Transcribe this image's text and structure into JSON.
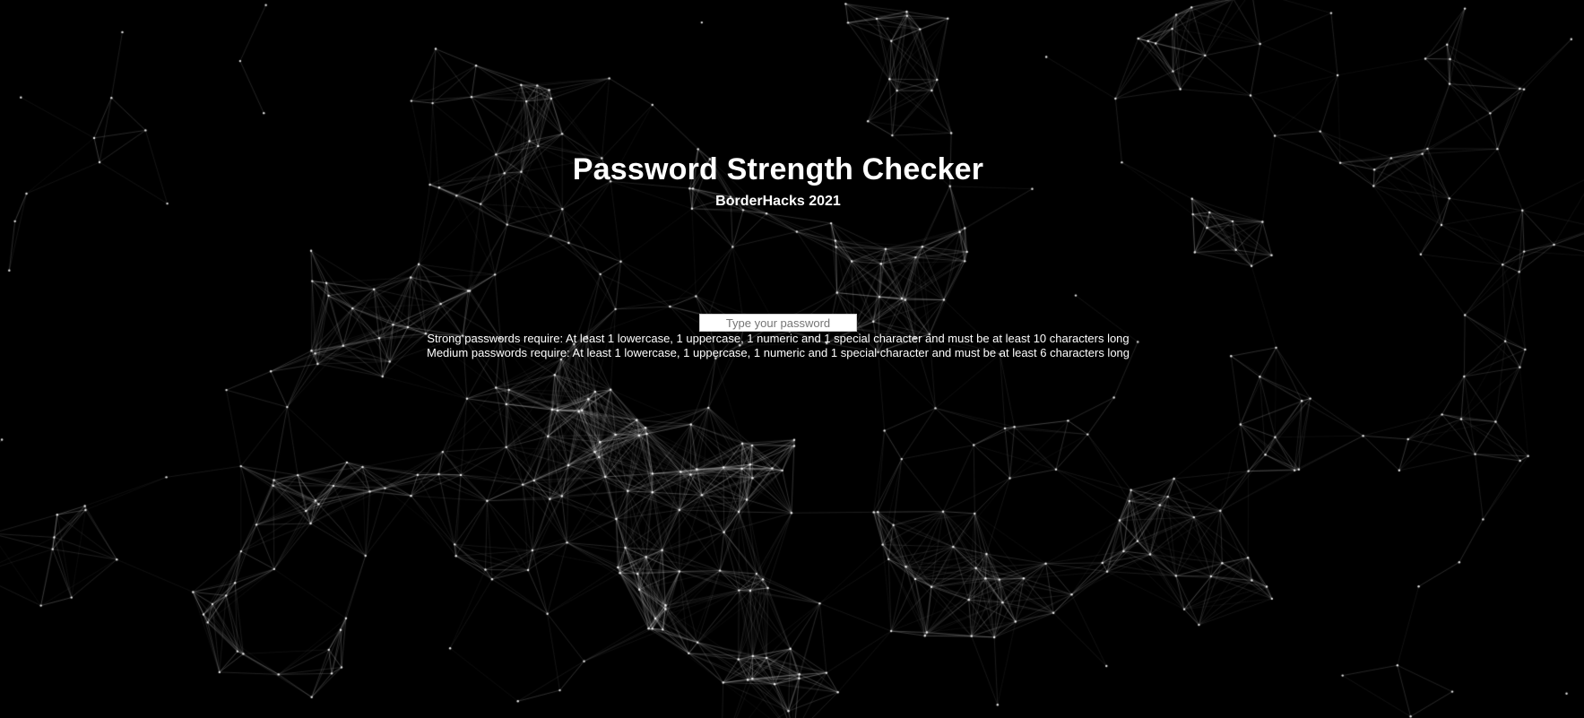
{
  "header": {
    "title": "Password Strength Checker",
    "subtitle": "BorderHacks 2021"
  },
  "password_field": {
    "value": "",
    "placeholder": "Type your password"
  },
  "requirements": {
    "strong": "Strong passwords require: At least 1 lowercase, 1 uppercase, 1 numeric and 1 special character and must be at least 10 characters long",
    "medium": "Medium passwords require: At least 1 lowercase, 1 uppercase, 1 numeric and 1 special character and must be at least 6 characters long"
  },
  "colors": {
    "background": "#000000",
    "text": "#ffffff",
    "particle": "#ffffff"
  },
  "background_effect": "particle-network"
}
